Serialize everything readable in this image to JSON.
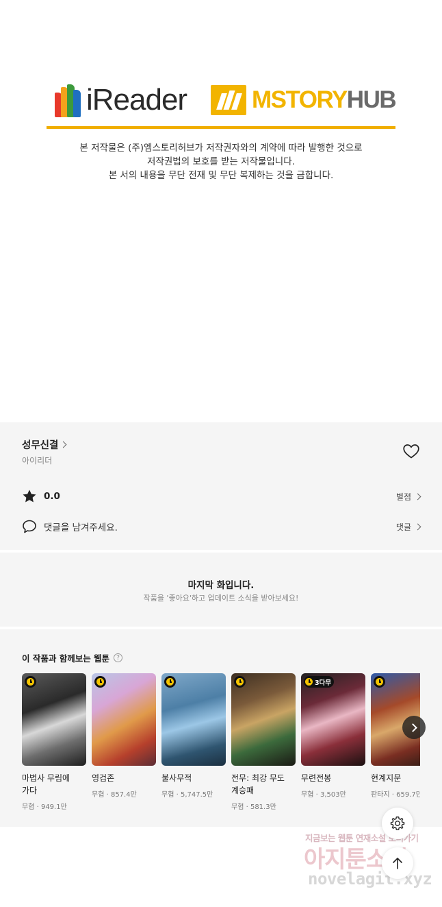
{
  "banner": {
    "ireader_logo_text": "iReader",
    "mstory_logo_text": "MSTORYHUB",
    "notice_lines": [
      "본 저작물은 (주)엠스토리허브가 저작권자와의 계약에 따라 발행한 것으로",
      "저작권법의 보호를 받는 저작물입니다.",
      "본 서의 내용을 무단 전재 및 무단 복제하는 것을 금합니다."
    ],
    "accent_color": "#f0ad00"
  },
  "series": {
    "title": "성무신결",
    "author": "아이리더",
    "like_icon": "heart-icon",
    "rating_value": "0.0",
    "rating_link": "별점",
    "comment_prompt": "댓글을 남겨주세요.",
    "comment_link": "댓글"
  },
  "last_episode": {
    "title": "마지막 화입니다.",
    "subtitle": "작품을 '좋아요'하고 업데이트 소식을 받아보세요!"
  },
  "recommendations": {
    "heading": "이 작품과 함께보는 웹툰",
    "help_icon": "?",
    "items": [
      {
        "name": "마법사 무림에 가다",
        "genre": "무협",
        "views": "949.1만",
        "badge": "clock",
        "badge_text": ""
      },
      {
        "name": "영검존",
        "genre": "무협",
        "views": "857.4만",
        "badge": "clock",
        "badge_text": ""
      },
      {
        "name": "불사무적",
        "genre": "무협",
        "views": "5,747.5만",
        "badge": "clock",
        "badge_text": ""
      },
      {
        "name": "전무: 최강 무도 계승패",
        "genre": "무협",
        "views": "581.3만",
        "badge": "clock",
        "badge_text": ""
      },
      {
        "name": "무련전봉",
        "genre": "무협",
        "views": "3,503만",
        "badge": "3free",
        "badge_text": "3다무"
      },
      {
        "name": "현계지문",
        "genre": "판타지",
        "views": "659.7만",
        "badge": "clock",
        "badge_text": ""
      }
    ],
    "next_icon": "chevron-right-icon"
  },
  "floating": {
    "settings_icon": "gear-icon",
    "top_icon": "arrow-up-icon"
  },
  "watermark": {
    "line1": "지금보는 웹툰 연재소설 보러가기",
    "line2": "아지툰소설",
    "line3": "novelagit.xyz"
  }
}
